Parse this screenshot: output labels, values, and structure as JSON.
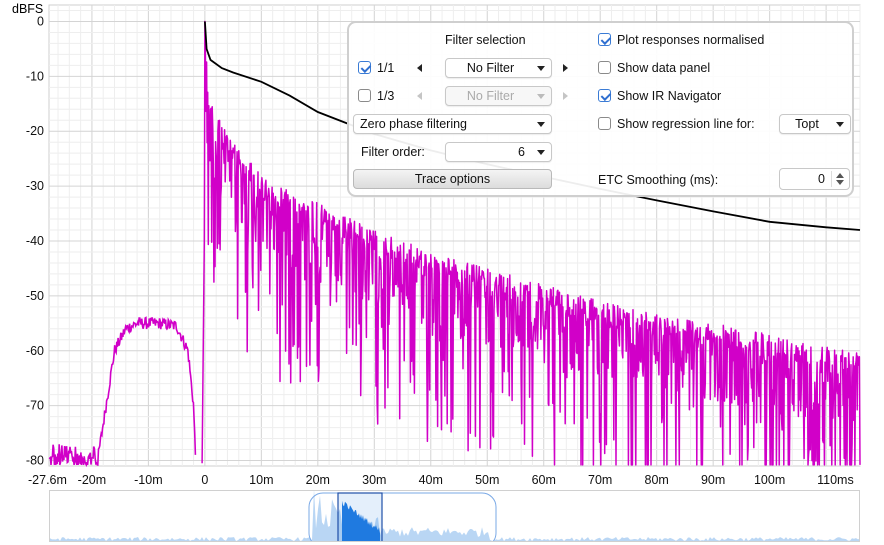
{
  "chart_data": {
    "type": "line",
    "ylabel": "dBFS",
    "xlabel": "",
    "x_unit_ms": true,
    "xlim": [
      -27.6,
      116
    ],
    "ylim": [
      -81,
      3
    ],
    "y_ticks": [
      0,
      -10,
      -20,
      -30,
      -40,
      -50,
      -60,
      -70,
      -80
    ],
    "y_tick_labels": [
      "0",
      "-10",
      "-20",
      "-30",
      "-40",
      "-50",
      "-60",
      "-70",
      "-80"
    ],
    "x_ticks": [
      -27.6,
      -20,
      -10,
      0,
      10,
      20,
      30,
      40,
      50,
      60,
      70,
      80,
      90,
      100,
      110
    ],
    "x_tick_labels": [
      "-27.6m",
      "-20m",
      "-10m",
      "0",
      "10m",
      "20m",
      "30m",
      "40m",
      "50m",
      "60m",
      "70m",
      "80m",
      "90m",
      "100m",
      "110ms"
    ],
    "grid": true,
    "series": [
      {
        "name": "",
        "color": "#000000",
        "style": "schroeder-decay",
        "points": [
          [
            0,
            0
          ],
          [
            0.3,
            -5
          ],
          [
            1,
            -7
          ],
          [
            3,
            -8.5
          ],
          [
            5,
            -9.3
          ],
          [
            10,
            -11
          ],
          [
            15,
            -13.5
          ],
          [
            20,
            -16.5
          ],
          [
            25,
            -18.5
          ],
          [
            30,
            -20.5
          ],
          [
            40,
            -23.5
          ],
          [
            50,
            -26
          ],
          [
            60,
            -28.3
          ],
          [
            70,
            -30.5
          ],
          [
            80,
            -32.6
          ],
          [
            90,
            -34.6
          ],
          [
            100,
            -36.5
          ],
          [
            110,
            -37.5
          ],
          [
            116,
            -38
          ]
        ]
      },
      {
        "name": "",
        "color": "#d100c8",
        "style": "etc",
        "pre_ringing": [
          [
            -27.6,
            -80
          ],
          [
            -19,
            -80
          ],
          [
            -17.5,
            -70
          ],
          [
            -16,
            -60
          ],
          [
            -14,
            -56
          ],
          [
            -12,
            -55
          ],
          [
            -8,
            -55
          ],
          [
            -5,
            -55.5
          ],
          [
            -3,
            -60
          ],
          [
            -2,
            -70
          ],
          [
            -1.6,
            -81
          ]
        ],
        "envelope": [
          [
            0,
            0
          ],
          [
            0.5,
            -11
          ],
          [
            1,
            -15
          ],
          [
            5,
            -22
          ],
          [
            10,
            -28
          ],
          [
            20,
            -33
          ],
          [
            30,
            -38
          ],
          [
            40,
            -42
          ],
          [
            50,
            -45
          ],
          [
            60,
            -48
          ],
          [
            70,
            -51
          ],
          [
            80,
            -53
          ],
          [
            90,
            -55
          ],
          [
            100,
            -57
          ],
          [
            110,
            -59
          ],
          [
            116,
            -60
          ]
        ]
      }
    ]
  },
  "filter_panel": {
    "title": "Filter selection",
    "row1": {
      "label": "1/1",
      "checked": true,
      "filter": "No Filter"
    },
    "row2": {
      "label": "1/3",
      "checked": false,
      "filter": "No Filter"
    },
    "phase": "Zero phase filtering",
    "order_label": "Filter order:",
    "order_value": "6",
    "trace_button": "Trace options",
    "plot_normalised": {
      "label": "Plot responses normalised",
      "checked": true
    },
    "show_data_panel": {
      "label": "Show data panel",
      "checked": false
    },
    "show_ir_navigator": {
      "label": "Show IR Navigator",
      "checked": true
    },
    "regression": {
      "label": "Show regression line for:",
      "checked": false,
      "value": "Topt"
    },
    "etc_smoothing": {
      "label": "ETC Smoothing (ms):",
      "value": "0"
    }
  },
  "colors": {
    "etc": "#d100c8",
    "decay": "#000000",
    "grid": "#e2e2e2",
    "navigator_accent": "#1f7ae0"
  }
}
